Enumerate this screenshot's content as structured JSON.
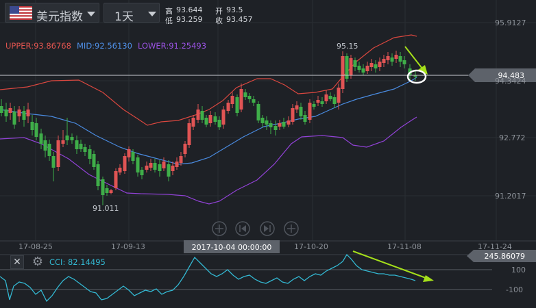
{
  "toolbar": {
    "symbol_label": "美元指数",
    "period_label": "1天"
  },
  "ohlc": {
    "high_label": "高",
    "high": "93.644",
    "low_label": "低",
    "low": "93.259",
    "open_label": "开",
    "open": "93.5",
    "close_label": "收",
    "close": "93.457"
  },
  "boll": {
    "upper": "UPPER:93.86768",
    "mid": "MID:92.56130",
    "lower": "LOWER:91.25493"
  },
  "cci": {
    "label": "CCI: 82.14495",
    "current_badge": "245.86079",
    "upper_level": "100",
    "lower_level": "-100"
  },
  "axis": {
    "price_ticks": [
      "95.9127",
      "94.3424",
      "92.772",
      "91.2017"
    ],
    "current_price_badge": "94.483",
    "date_ticks": [
      "17-08-25",
      "17-09-13",
      "17-10-20",
      "17-11-08",
      "17-11-24"
    ],
    "crosshair_date": "2017-10-04 00:00:00"
  },
  "annotations": {
    "max_label": "95.15",
    "min_label": "91.011"
  },
  "colors": {
    "background": "#1e2126",
    "up_candle": "#e05454",
    "down_candle": "#3fae49",
    "upper_band": "#d9473f",
    "mid_band": "#4a8be0",
    "lower_band": "#9142d6",
    "cci_line": "#33b8d2",
    "arrow": "#a5e01a"
  },
  "icons": [
    "us-flag-icon",
    "chevron-down-icon",
    "zoom-in-icon",
    "first-page-icon",
    "last-page-icon",
    "zoom-out-icon",
    "close-icon",
    "gear-icon"
  ]
}
